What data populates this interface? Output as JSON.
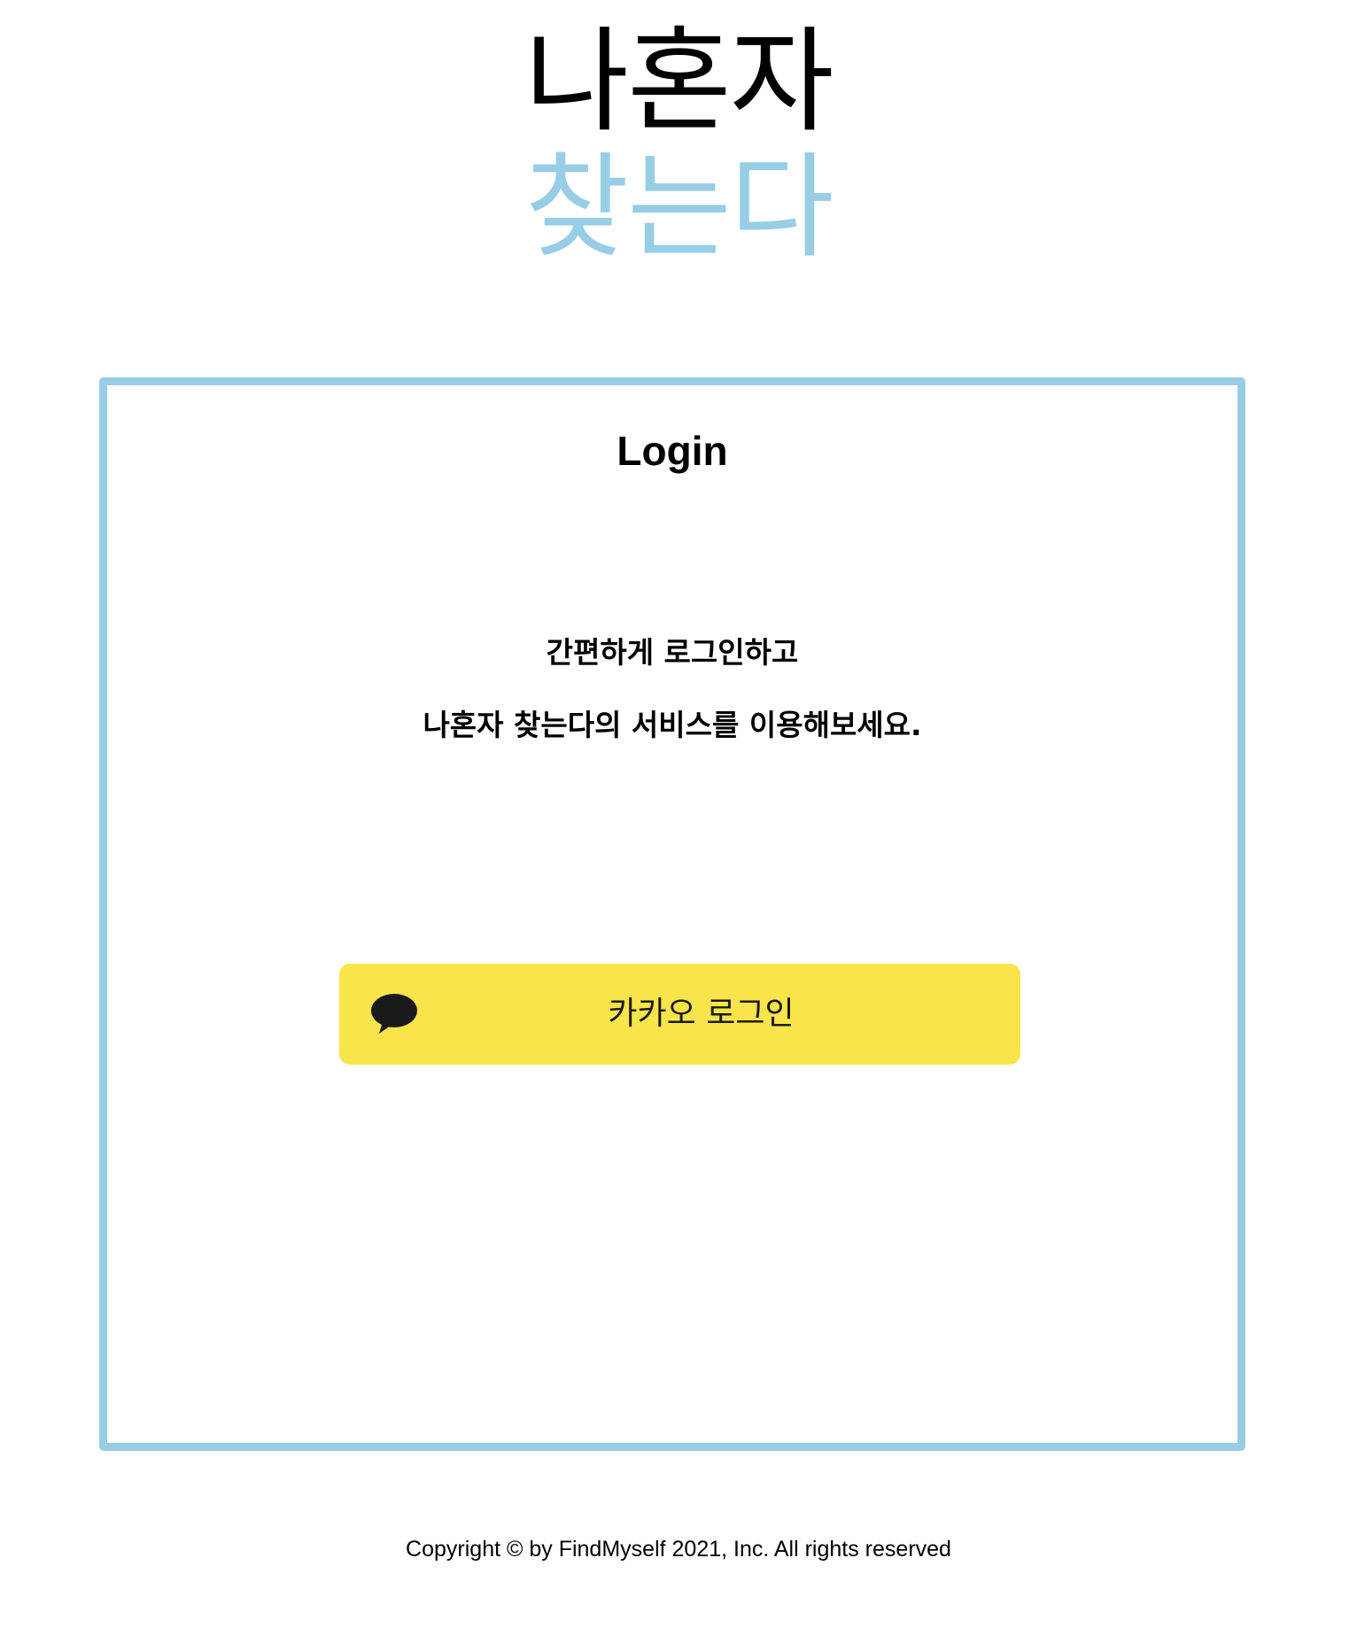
{
  "logo": {
    "line1": "나혼자",
    "line2": "찾는다"
  },
  "login": {
    "title": "Login",
    "intro_line1": "간편하게 로그인하고",
    "intro_line2": "나혼자 찾는다의 서비스를 이용해보세요.",
    "kakao_button_label": "카카오 로그인",
    "kakao_icon": "speech-bubble-icon"
  },
  "footer": {
    "copyright": "Copyright © by FindMyself 2021, Inc. All rights reserved"
  },
  "colors": {
    "accent": "#98cde6",
    "kakao_yellow": "#f9e54b",
    "text": "#000000"
  }
}
